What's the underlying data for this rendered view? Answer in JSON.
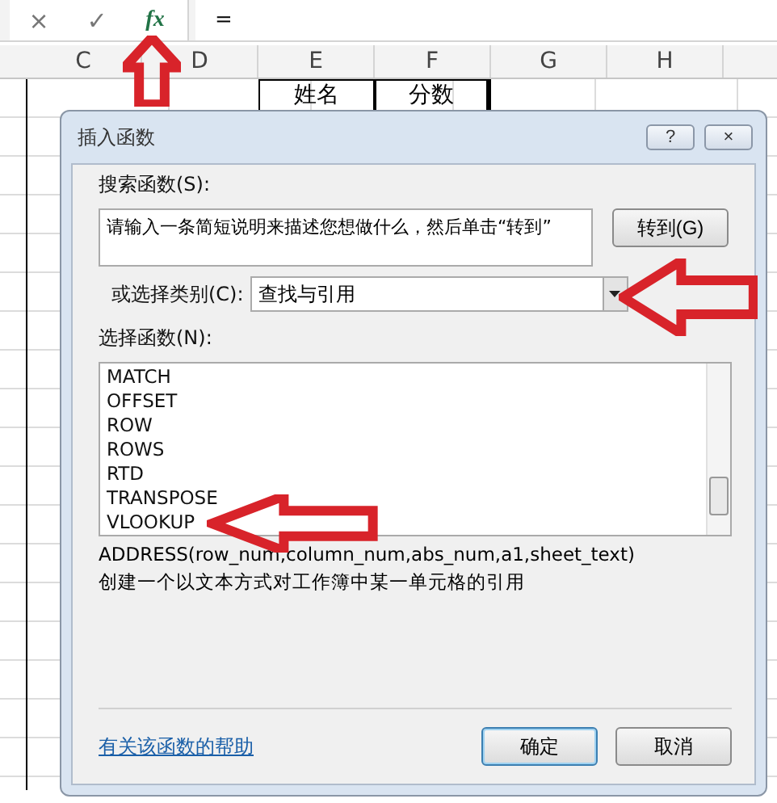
{
  "formula_bar": {
    "cancel": "×",
    "enter": "✓",
    "function": "fx",
    "value": "="
  },
  "columns": [
    "C",
    "D",
    "E",
    "F",
    "G",
    "H"
  ],
  "cell_e1": "姓名",
  "cell_f1": "分数",
  "dialog": {
    "title": "插入函数",
    "help": "?",
    "close": "×",
    "search_label": "搜索函数(S):",
    "search_value": "请输入一条简短说明来描述您想做什么，然后单击“转到”",
    "go_button": "转到(G)",
    "category_label": "或选择类别(C):",
    "category_value": "查找与引用",
    "functions_label": "选择函数(N):",
    "functions": [
      {
        "name": "MATCH",
        "selected": false
      },
      {
        "name": "OFFSET",
        "selected": false
      },
      {
        "name": "ROW",
        "selected": false
      },
      {
        "name": "ROWS",
        "selected": false
      },
      {
        "name": "RTD",
        "selected": false
      },
      {
        "name": "TRANSPOSE",
        "selected": false
      },
      {
        "name": "VLOOKUP",
        "selected": false
      }
    ],
    "syntax": "ADDRESS(row_num,column_num,abs_num,a1,sheet_text)",
    "description": "创建一个以文本方式对工作簿中某一单元格的引用",
    "help_link": "有关该函数的帮助",
    "ok": "确定",
    "cancel": "取消"
  }
}
